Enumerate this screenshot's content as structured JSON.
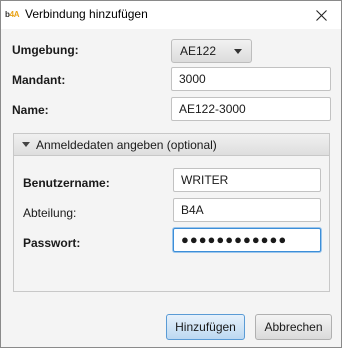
{
  "window": {
    "title": "Verbindung hinzufügen",
    "app_icon": "b4A-logo-icon"
  },
  "form": {
    "environment_label": "Umgebung:",
    "environment_value": "AE122",
    "mandant_label": "Mandant:",
    "mandant_value": "3000",
    "name_label": "Name:",
    "name_value": "AE122-3000"
  },
  "credentials": {
    "header": "Anmeldedaten angeben (optional)",
    "username_label": "Benutzername:",
    "username_value": "WRITER",
    "department_label": "Abteilung:",
    "department_value": "B4A",
    "password_label": "Passwort:",
    "password_mask": "●●●●●●●●●●●●"
  },
  "buttons": {
    "add": "Hinzufügen",
    "cancel": "Abbrechen"
  },
  "colors": {
    "accent": "#3c8ed8",
    "primary_button": "#bcd8f1"
  }
}
